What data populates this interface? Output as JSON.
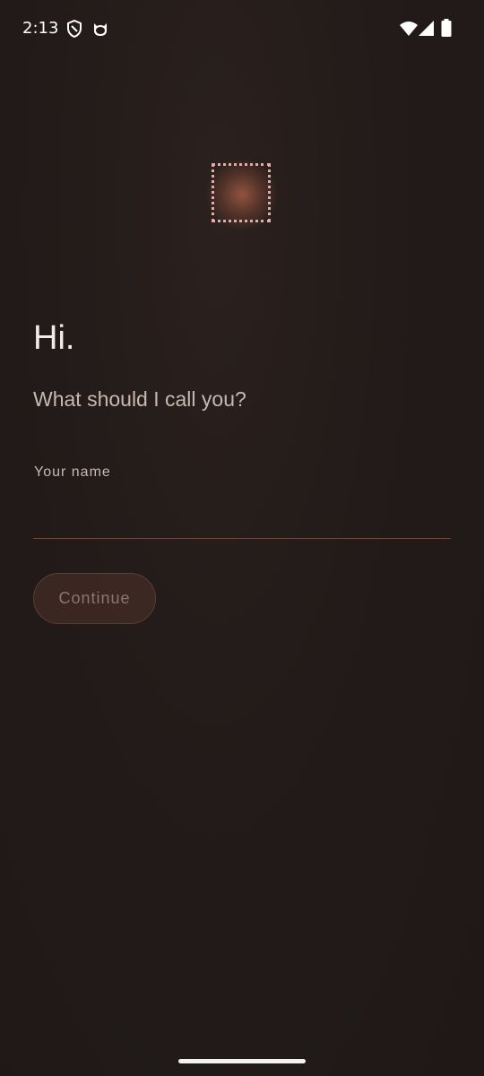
{
  "status_bar": {
    "time": "2:13",
    "left_icons": [
      "shield-icon",
      "cat-face-icon"
    ],
    "right_icons": [
      "wifi-icon",
      "cell-signal-icon",
      "battery-icon"
    ]
  },
  "logo": {
    "icon": "dotted-square-glow-logo",
    "glow_color": "#c86e50",
    "dot_color": "#e9a8a4"
  },
  "onboarding": {
    "greeting": "Hi.",
    "prompt": "What should I call you?",
    "name_field": {
      "label": "Your name",
      "value": ""
    },
    "continue_label": "Continue"
  },
  "colors": {
    "background": "#221b19",
    "accent": "#6a4a3f",
    "button_text_disabled": "#8a766e"
  }
}
